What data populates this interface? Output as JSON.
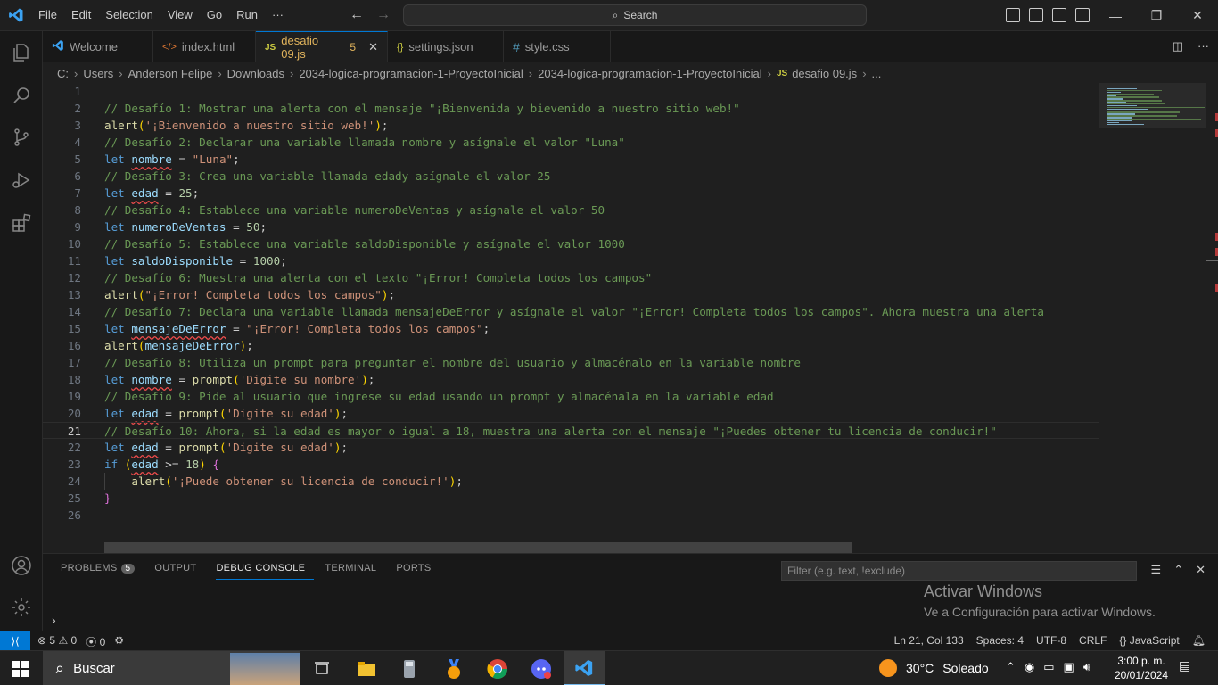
{
  "menu": [
    "File",
    "Edit",
    "Selection",
    "View",
    "Go",
    "Run",
    "···"
  ],
  "command_center": {
    "label": "Search"
  },
  "window_controls": [
    "—",
    "❐",
    "✕"
  ],
  "tabs": [
    {
      "label": "Welcome",
      "icon": "vscode-icon",
      "active": false
    },
    {
      "label": "index.html",
      "icon": "html-icon",
      "active": false
    },
    {
      "label": "desafio 09.js",
      "icon": "js-icon",
      "active": true,
      "badge": "5"
    },
    {
      "label": "settings.json",
      "icon": "json-icon",
      "active": false
    },
    {
      "label": "style.css",
      "icon": "css-icon",
      "active": false
    }
  ],
  "breadcrumb": [
    "C:",
    "Users",
    "Anderson Felipe",
    "Downloads",
    "2034-logica-programacion-1-ProyectoInicial",
    "2034-logica-programacion-1-ProyectoInicial",
    "desafio 09.js",
    "..."
  ],
  "editor": {
    "line_numbers": [
      "1",
      "2",
      "3",
      "4",
      "5",
      "6",
      "7",
      "8",
      "9",
      "10",
      "11",
      "12",
      "13",
      "14",
      "15",
      "16",
      "17",
      "18",
      "19",
      "20",
      "21",
      "22",
      "23",
      "24",
      "25",
      "26"
    ],
    "active_line": 21,
    "lines": [
      "",
      "// Desafío 1: Mostrar una alerta con el mensaje \"¡Bienvenida y bievenido a nuestro sitio web!\"",
      "alert('¡Bienvenido a nuestro sitio web!');",
      "// Desafío 2: Declarar una variable llamada nombre y asígnale el valor \"Luna\"",
      "let nombre = \"Luna\";",
      "// Desafío 3: Crea una variable llamada edady asígnale el valor 25",
      "let edad = 25;",
      "// Desafío 4: Establece una variable numeroDeVentas y asígnale el valor 50",
      "let numeroDeVentas = 50;",
      "// Desafío 5: Establece una variable saldoDisponible y asígnale el valor 1000",
      "let saldoDisponible = 1000;",
      "// Desafío 6: Muestra una alerta con el texto \"¡Error! Completa todos los campos\"",
      "alert(\"¡Error! Completa todos los campos\");",
      "// Desafío 7: Declara una variable llamada mensajeDeError y asígnale el valor \"¡Error! Completa todos los campos\". Ahora muestra una alerta",
      "let mensajeDeError = \"¡Error! Completa todos los campos\";",
      "alert(mensajeDeError);",
      "// Desafío 8: Utiliza un prompt para preguntar el nombre del usuario y almacénalo en la variable nombre",
      "let nombre = prompt('Digite su nombre');",
      "// Desafío 9: Pide al usuario que ingrese su edad usando un prompt y almacénala en la variable edad",
      "let edad = prompt('Digite su edad');",
      "// Desafío 10: Ahora, si la edad es mayor o igual a 18, muestra una alerta con el mensaje \"¡Puedes obtener tu licencia de conducir!\"",
      "let edad = prompt('Digite su edad');",
      "if (edad >= 18) {",
      "    alert('¡Puede obtener su licencia de conducir!');",
      "}",
      ""
    ]
  },
  "panel": {
    "tabs": [
      {
        "label": "PROBLEMS",
        "badge": "5"
      },
      {
        "label": "OUTPUT"
      },
      {
        "label": "DEBUG CONSOLE",
        "active": true
      },
      {
        "label": "TERMINAL"
      },
      {
        "label": "PORTS"
      }
    ],
    "filter_placeholder": "Filter (e.g. text, !exclude)",
    "prompt": "›"
  },
  "watermark": {
    "title": "Activar Windows",
    "subtitle": "Ve a Configuración para activar Windows."
  },
  "statusbar": {
    "remote": "⟩⟨",
    "errors": "5",
    "warnings": "0",
    "ports": "0",
    "position": "Ln 21, Col 133",
    "spaces": "Spaces: 4",
    "encoding": "UTF-8",
    "eol": "CRLF",
    "language": "JavaScript"
  },
  "taskbar": {
    "search": "Buscar",
    "weather_temp": "30°C",
    "weather_text": "Soleado",
    "time": "3:00 p. m.",
    "date": "20/01/2024"
  },
  "colors": {
    "accent": "#0078d4",
    "comment": "#6a9955",
    "keyword": "#569cd6",
    "string": "#ce9178",
    "number": "#b5cea8",
    "function": "#dcdcaa",
    "variable": "#9cdcfe"
  }
}
